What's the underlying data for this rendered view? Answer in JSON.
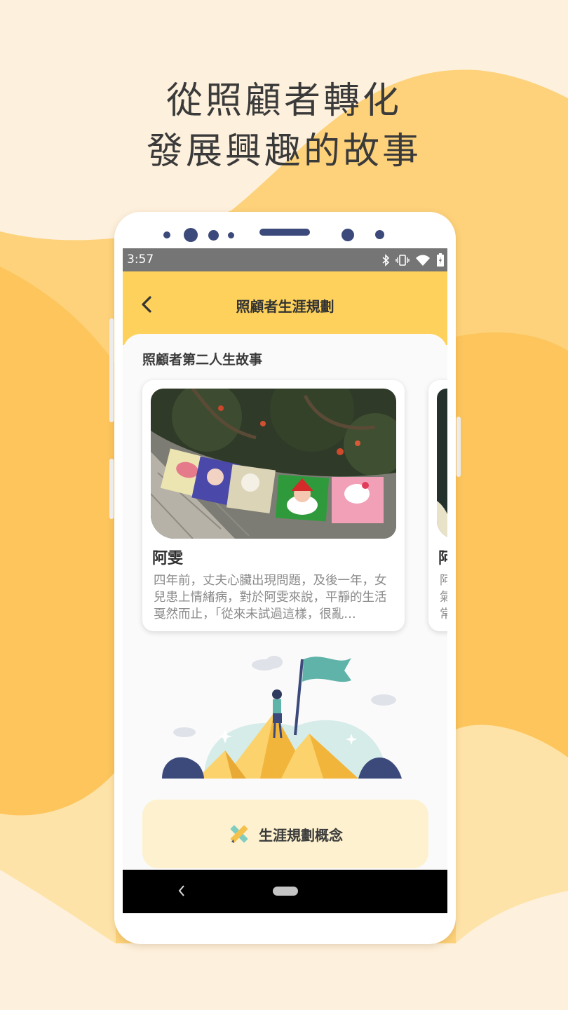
{
  "promo": {
    "line1": "從照顧者轉化",
    "line2": "發展興趣的故事"
  },
  "colors": {
    "background": "#fdf0dc",
    "wave_orange": "#fdc560",
    "appbar_yellow": "#fdd15b",
    "device_accent": "#3b4a7a"
  },
  "status_bar": {
    "time": "3:57",
    "icons": [
      "bluetooth-icon",
      "vibrate-icon",
      "wifi-icon",
      "battery-icon"
    ]
  },
  "app_bar": {
    "title": "照顧者生涯規劃",
    "back_icon": "chevron-left-icon"
  },
  "section": {
    "title": "照顧者第二人生故事"
  },
  "stories": [
    {
      "name": "阿雯",
      "excerpt": "四年前，丈夫心臟出現問題，及後一年，女兒患上情緒病，對於阿雯來說，平靜的生活戛然而止，「從來未試過這樣，很亂…"
    },
    {
      "name": "阿",
      "excerpt": "阿氣常"
    }
  ],
  "concept_button": {
    "label": "生涯規劃概念",
    "icon": "ruler-pencil-icon"
  },
  "nav_bar": {
    "back_icon": "nav-back-icon",
    "home_icon": "nav-home-icon"
  }
}
